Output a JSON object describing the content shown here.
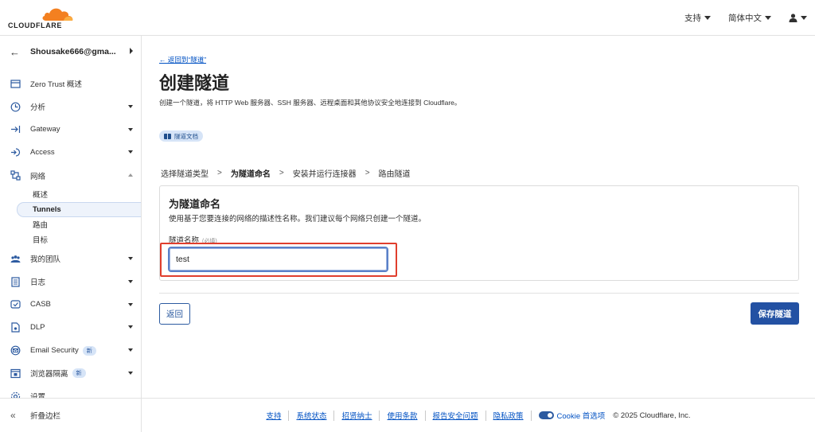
{
  "brand": {
    "logo_text": "CLOUDFLARE",
    "accent": "#f38020"
  },
  "topbar": {
    "support_label": "支持",
    "language_label": "简体中文",
    "user_icon": "user-icon"
  },
  "sidebar": {
    "account_name": "Shousake666@gma...",
    "items": [
      {
        "label": "Zero Trust 概述",
        "icon": "overview-icon",
        "caret": ""
      },
      {
        "label": "分析",
        "icon": "analytics-icon",
        "caret": "down"
      },
      {
        "label": "Gateway",
        "icon": "gateway-icon",
        "caret": "down"
      },
      {
        "label": "Access",
        "icon": "access-icon",
        "caret": "down"
      },
      {
        "label": "网络",
        "icon": "network-icon",
        "caret": "up"
      }
    ],
    "network_sub": [
      "概述",
      "Tunnels",
      "路由",
      "目标"
    ],
    "items_after": [
      {
        "label": "我的团队",
        "icon": "team-icon",
        "caret": "down",
        "badge": ""
      },
      {
        "label": "日志",
        "icon": "logs-icon",
        "caret": "down",
        "badge": ""
      },
      {
        "label": "CASB",
        "icon": "casb-icon",
        "caret": "down",
        "badge": ""
      },
      {
        "label": "DLP",
        "icon": "dlp-icon",
        "caret": "down",
        "badge": ""
      },
      {
        "label": "Email Security",
        "icon": "email-icon",
        "caret": "down",
        "badge": "新"
      },
      {
        "label": "浏览器隔离",
        "icon": "browser-isolation-icon",
        "caret": "down",
        "badge": "新"
      },
      {
        "label": "设置",
        "icon": "settings-icon",
        "caret": "",
        "badge": ""
      }
    ],
    "collapse_label": "折叠边栏"
  },
  "main": {
    "back_link": "← 返回到“隧道”",
    "title": "创建隧道",
    "description": "创建一个隧道，将 HTTP Web 服务器、SSH 服务器、远程桌面和其他协议安全地连接到 Cloudflare。",
    "doc_chip": "隧道文档",
    "steps": [
      "选择隧道类型",
      "为隧道命名",
      "安装并运行连接器",
      "路由隧道"
    ],
    "current_step": 1,
    "card": {
      "title": "为隧道命名",
      "description": "使用基于您要连接的网络的描述性名称。我们建议每个网络只创建一个隧道。",
      "field_label": "隧道名称",
      "field_required": "(必填)",
      "field_value": "test"
    },
    "back_button": "返回",
    "save_button": "保存隧道"
  },
  "footer": {
    "links": [
      "支持",
      "系统状态",
      "招贤纳士",
      "使用条款",
      "报告安全问题",
      "隐私政策"
    ],
    "cookie_label": "Cookie 首选项",
    "copyright": "© 2025 Cloudflare, Inc."
  }
}
